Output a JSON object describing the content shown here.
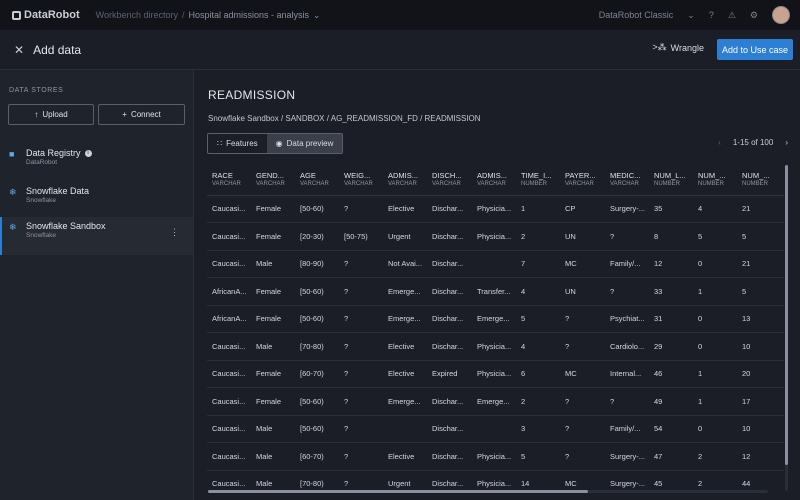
{
  "topbar": {
    "logo_text": "DataRobot",
    "crumb_1": "Workbench directory",
    "crumb_sep": "/",
    "crumb_2": "Hospital admissions - analysis",
    "account": "DataRobot Classic"
  },
  "header": {
    "title": "Add data",
    "wrangle_label": "Wrangle",
    "add_button": "Add to Use case"
  },
  "sidebar": {
    "section_label": "DATA STORES",
    "upload_label": "Upload",
    "connect_label": "Connect",
    "sources": [
      {
        "name": "Data Registry",
        "sub": "DataRobot"
      },
      {
        "name": "Snowflake Data",
        "sub": "Snowflake"
      },
      {
        "name": "Snowflake Sandbox",
        "sub": "Snowflake"
      }
    ]
  },
  "main": {
    "table_name": "READMISSION",
    "path": "Snowflake Sandbox / SANDBOX / AG_READMISSION_FD / READMISSION",
    "tab_features": "Features",
    "tab_preview": "Data preview",
    "pager": "1-15 of 100"
  },
  "table": {
    "columns": [
      {
        "name": "RACE",
        "type": "VARCHAR"
      },
      {
        "name": "GEND...",
        "type": "VARCHAR"
      },
      {
        "name": "AGE",
        "type": "VARCHAR"
      },
      {
        "name": "WEIG...",
        "type": "VARCHAR"
      },
      {
        "name": "ADMIS...",
        "type": "VARCHAR"
      },
      {
        "name": "DISCH...",
        "type": "VARCHAR"
      },
      {
        "name": "ADMIS...",
        "type": "VARCHAR"
      },
      {
        "name": "TIME_I...",
        "type": "NUMBER"
      },
      {
        "name": "PAYER...",
        "type": "VARCHAR"
      },
      {
        "name": "MEDIC...",
        "type": "VARCHAR"
      },
      {
        "name": "NUM_L...",
        "type": "NUMBER"
      },
      {
        "name": "NUM_...",
        "type": "NUMBER"
      },
      {
        "name": "NUM_...",
        "type": "NUMBER"
      }
    ],
    "rows": [
      [
        "Caucasi...",
        "Female",
        "[50-60)",
        "?",
        "Elective",
        "Dischar...",
        "Physicia...",
        "1",
        "CP",
        "Surgery-...",
        "35",
        "4",
        "21"
      ],
      [
        "Caucasi...",
        "Female",
        "[20-30)",
        "[50-75)",
        "Urgent",
        "Dischar...",
        "Physicia...",
        "2",
        "UN",
        "?",
        "8",
        "5",
        "5"
      ],
      [
        "Caucasi...",
        "Male",
        "[80-90)",
        "?",
        "Not Avai...",
        "Dischar...",
        "",
        "7",
        "MC",
        "Family/...",
        "12",
        "0",
        "21"
      ],
      [
        "AfricanA...",
        "Female",
        "[50-60)",
        "?",
        "Emerge...",
        "Dischar...",
        "Transfer...",
        "4",
        "UN",
        "?",
        "33",
        "1",
        "5"
      ],
      [
        "AfricanA...",
        "Female",
        "[50-60)",
        "?",
        "Emerge...",
        "Dischar...",
        "Emerge...",
        "5",
        "?",
        "Psychiat...",
        "31",
        "0",
        "13"
      ],
      [
        "Caucasi...",
        "Male",
        "[70-80)",
        "?",
        "Elective",
        "Dischar...",
        "Physicia...",
        "4",
        "?",
        "Cardiolo...",
        "29",
        "0",
        "10"
      ],
      [
        "Caucasi...",
        "Female",
        "[60-70)",
        "?",
        "Elective",
        "Expired",
        "Physicia...",
        "6",
        "MC",
        "Internal...",
        "46",
        "1",
        "20"
      ],
      [
        "Caucasi...",
        "Female",
        "[50-60)",
        "?",
        "Emerge...",
        "Dischar...",
        "Emerge...",
        "2",
        "?",
        "?",
        "49",
        "1",
        "17"
      ],
      [
        "Caucasi...",
        "Male",
        "[50-60)",
        "?",
        "",
        "Dischar...",
        "",
        "3",
        "?",
        "Family/...",
        "54",
        "0",
        "10"
      ],
      [
        "Caucasi...",
        "Male",
        "[60-70)",
        "?",
        "Elective",
        "Dischar...",
        "Physicia...",
        "5",
        "?",
        "Surgery-...",
        "47",
        "2",
        "12"
      ],
      [
        "Caucasi...",
        "Male",
        "[70-80)",
        "?",
        "Urgent",
        "Dischar...",
        "Physicia...",
        "14",
        "MC",
        "Surgery-...",
        "45",
        "2",
        "44"
      ]
    ]
  }
}
